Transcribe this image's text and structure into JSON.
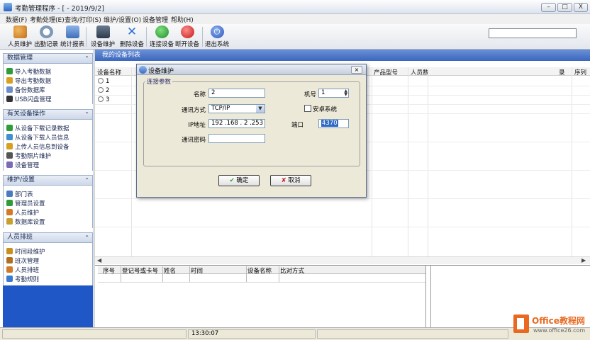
{
  "window": {
    "title": "考勤管理程序 - [ - 2019/9/2]",
    "min": "–",
    "max": "□",
    "close": "X"
  },
  "menu": [
    "数据(F)",
    "考勤处理(E)",
    "查询/打印(S)",
    "维护/设置(O)",
    "设备管理",
    "帮助(H)"
  ],
  "toolbar": [
    {
      "label": "人员维护",
      "icon": "users-icon",
      "color": "#d48a2a"
    },
    {
      "label": "出勤记录",
      "icon": "stopwatch-icon",
      "color": "#6f8fb3"
    },
    {
      "label": "统计报表",
      "icon": "report-monitor-icon",
      "color": "#5a86c8"
    },
    {
      "label": "设备维护",
      "icon": "device-icon",
      "color": "#4a5a70"
    },
    {
      "label": "删除设备",
      "icon": "delete-x-icon",
      "color": "#2d6fd6"
    },
    {
      "label": "连接设备",
      "icon": "connect-play-icon",
      "color": "#2aa63a"
    },
    {
      "label": "断开设备",
      "icon": "disconnect-stop-icon",
      "color": "#d62828"
    },
    {
      "label": "退出系统",
      "icon": "power-icon",
      "color": "#2f5fc8"
    }
  ],
  "sidebar": {
    "sections": [
      {
        "title": "数据管理",
        "items": [
          "导入考勤数据",
          "导出考勤数据",
          "备份数据库",
          "USB闪盘管理"
        ]
      },
      {
        "title": "有关设备操作",
        "items": [
          "从设备下载记录数据",
          "从设备下载人员信息",
          "上传人员信息到设备",
          "考勤照片维护",
          "设备管理"
        ]
      },
      {
        "title": "维护/设置",
        "items": [
          "部门表",
          "管理员设置",
          "人员维护",
          "数据库设置"
        ]
      },
      {
        "title": "人员排班",
        "items": [
          "时间段维护",
          "班次管理",
          "人员排班",
          "考勤规则"
        ]
      }
    ],
    "chevron": "⌃"
  },
  "main": {
    "header": "我的设备列表",
    "columns": [
      "设备名称",
      "产品型号",
      "人员数",
      "录",
      "序列"
    ],
    "devices": [
      "1",
      "2",
      "3"
    ]
  },
  "lower_table": {
    "columns": [
      "序号",
      "登记号或卡号",
      "姓名",
      "时间",
      "设备名称",
      "比对方式"
    ]
  },
  "status": {
    "time": "13:30:07"
  },
  "dialog": {
    "title": "设备维护",
    "close": "×",
    "group": "连接参数",
    "name_label": "名称",
    "name_value": "2",
    "machine_label": "机号",
    "machine_value": "1",
    "comm_label": "通讯方式",
    "comm_value": "TCP/IP",
    "android_label": "安卓系统",
    "ip_label": "IP地址",
    "ip_value": "192 .168 . 2  .253",
    "port_label": "端口",
    "port_value": "4370",
    "pwd_label": "通讯密码",
    "pwd_value": "",
    "ok": "确定",
    "cancel": "取消"
  },
  "watermark": {
    "line1": "Office教程网",
    "line2": "www.office26.com"
  },
  "colors": {
    "accent": "#3a66bd",
    "sidebar_blue": "#1f57c6",
    "ok_green": "#2a9d2a",
    "cancel_red": "#c82020",
    "watermark_orange": "#e8691f"
  }
}
